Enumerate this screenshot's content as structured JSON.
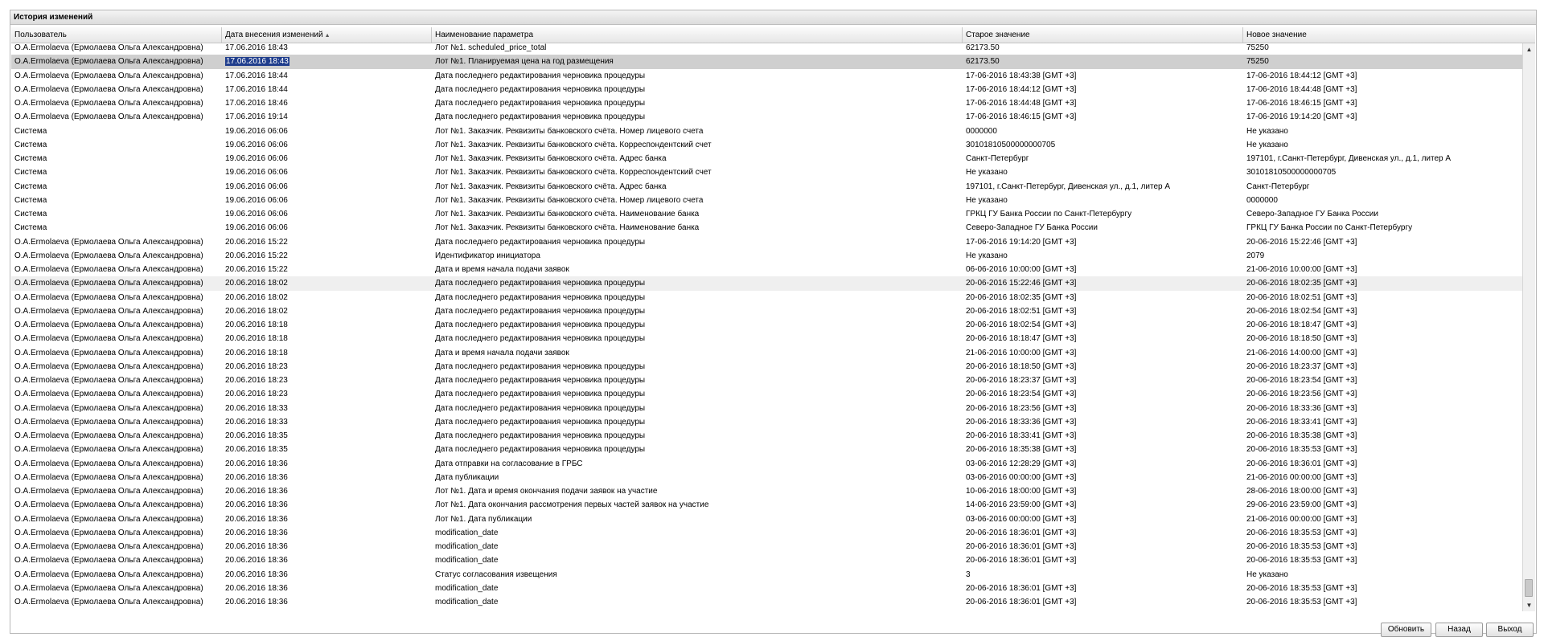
{
  "window": {
    "title": "История изменений"
  },
  "grid": {
    "columns": [
      "Пользователь",
      "Дата внесения изменений",
      "Наименование параметра",
      "Старое значение",
      "Новое значение"
    ],
    "sort_column": 1,
    "selected_row": 1,
    "hover_row": 17,
    "rows": [
      [
        "O.A.Ermolaeva (Ермолаева Ольга Александровна)",
        "17.06.2016 18:43",
        "Лот №1. scheduled_price_total",
        "62173.50",
        "75250"
      ],
      [
        "O.A.Ermolaeva (Ермолаева Ольга Александровна)",
        "17.06.2016 18:43",
        "Лот №1. Планируемая цена на год размещения",
        "62173.50",
        "75250"
      ],
      [
        "O.A.Ermolaeva (Ермолаева Ольга Александровна)",
        "17.06.2016 18:44",
        "Дата последнего редактирования черновика процедуры",
        "17-06-2016 18:43:38 [GMT +3]",
        "17-06-2016 18:44:12 [GMT +3]"
      ],
      [
        "O.A.Ermolaeva (Ермолаева Ольга Александровна)",
        "17.06.2016 18:44",
        "Дата последнего редактирования черновика процедуры",
        "17-06-2016 18:44:12 [GMT +3]",
        "17-06-2016 18:44:48 [GMT +3]"
      ],
      [
        "O.A.Ermolaeva (Ермолаева Ольга Александровна)",
        "17.06.2016 18:46",
        "Дата последнего редактирования черновика процедуры",
        "17-06-2016 18:44:48 [GMT +3]",
        "17-06-2016 18:46:15 [GMT +3]"
      ],
      [
        "O.A.Ermolaeva (Ермолаева Ольга Александровна)",
        "17.06.2016 19:14",
        "Дата последнего редактирования черновика процедуры",
        "17-06-2016 18:46:15 [GMT +3]",
        "17-06-2016 19:14:20 [GMT +3]"
      ],
      [
        "Система",
        "19.06.2016 06:06",
        "Лот №1. Заказчик. Реквизиты банковского счёта. Номер лицевого счета",
        "0000000",
        "Не указано"
      ],
      [
        "Система",
        "19.06.2016 06:06",
        "Лот №1. Заказчик. Реквизиты банковского счёта. Корреспондентский счет",
        "30101810500000000705",
        "Не указано"
      ],
      [
        "Система",
        "19.06.2016 06:06",
        "Лот №1. Заказчик. Реквизиты банковского счёта. Адрес банка",
        "Санкт-Петербург",
        "197101, г.Санкт-Петербург, Дивенская ул., д.1, литер А"
      ],
      [
        "Система",
        "19.06.2016 06:06",
        "Лот №1. Заказчик. Реквизиты банковского счёта. Корреспондентский счет",
        "Не указано",
        "30101810500000000705"
      ],
      [
        "Система",
        "19.06.2016 06:06",
        "Лот №1. Заказчик. Реквизиты банковского счёта. Адрес банка",
        "197101, г.Санкт-Петербург, Дивенская ул., д.1, литер А",
        "Санкт-Петербург"
      ],
      [
        "Система",
        "19.06.2016 06:06",
        "Лот №1. Заказчик. Реквизиты банковского счёта. Номер лицевого счета",
        "Не указано",
        "0000000"
      ],
      [
        "Система",
        "19.06.2016 06:06",
        "Лот №1. Заказчик. Реквизиты банковского счёта. Наименование банка",
        "ГРКЦ ГУ Банка России по Санкт-Петербургу",
        "Северо-Западное ГУ Банка России"
      ],
      [
        "Система",
        "19.06.2016 06:06",
        "Лот №1. Заказчик. Реквизиты банковского счёта. Наименование банка",
        "Северо-Западное ГУ Банка России",
        "ГРКЦ ГУ Банка России по Санкт-Петербургу"
      ],
      [
        "O.A.Ermolaeva (Ермолаева Ольга Александровна)",
        "20.06.2016 15:22",
        "Дата последнего редактирования черновика процедуры",
        "17-06-2016 19:14:20 [GMT +3]",
        "20-06-2016 15:22:46 [GMT +3]"
      ],
      [
        "O.A.Ermolaeva (Ермолаева Ольга Александровна)",
        "20.06.2016 15:22",
        "Идентификатор инициатора",
        "Не указано",
        "2079"
      ],
      [
        "O.A.Ermolaeva (Ермолаева Ольга Александровна)",
        "20.06.2016 15:22",
        "Дата и время начала подачи заявок",
        "06-06-2016 10:00:00 [GMT +3]",
        "21-06-2016 10:00:00 [GMT +3]"
      ],
      [
        "O.A.Ermolaeva (Ермолаева Ольга Александровна)",
        "20.06.2016 18:02",
        "Дата последнего редактирования черновика процедуры",
        "20-06-2016 15:22:46 [GMT +3]",
        "20-06-2016 18:02:35 [GMT +3]"
      ],
      [
        "O.A.Ermolaeva (Ермолаева Ольга Александровна)",
        "20.06.2016 18:02",
        "Дата последнего редактирования черновика процедуры",
        "20-06-2016 18:02:35 [GMT +3]",
        "20-06-2016 18:02:51 [GMT +3]"
      ],
      [
        "O.A.Ermolaeva (Ермолаева Ольга Александровна)",
        "20.06.2016 18:02",
        "Дата последнего редактирования черновика процедуры",
        "20-06-2016 18:02:51 [GMT +3]",
        "20-06-2016 18:02:54 [GMT +3]"
      ],
      [
        "O.A.Ermolaeva (Ермолаева Ольга Александровна)",
        "20.06.2016 18:18",
        "Дата последнего редактирования черновика процедуры",
        "20-06-2016 18:02:54 [GMT +3]",
        "20-06-2016 18:18:47 [GMT +3]"
      ],
      [
        "O.A.Ermolaeva (Ермолаева Ольга Александровна)",
        "20.06.2016 18:18",
        "Дата последнего редактирования черновика процедуры",
        "20-06-2016 18:18:47 [GMT +3]",
        "20-06-2016 18:18:50 [GMT +3]"
      ],
      [
        "O.A.Ermolaeva (Ермолаева Ольга Александровна)",
        "20.06.2016 18:18",
        "Дата и время начала подачи заявок",
        "21-06-2016 10:00:00 [GMT +3]",
        "21-06-2016 14:00:00 [GMT +3]"
      ],
      [
        "O.A.Ermolaeva (Ермолаева Ольга Александровна)",
        "20.06.2016 18:23",
        "Дата последнего редактирования черновика процедуры",
        "20-06-2016 18:18:50 [GMT +3]",
        "20-06-2016 18:23:37 [GMT +3]"
      ],
      [
        "O.A.Ermolaeva (Ермолаева Ольга Александровна)",
        "20.06.2016 18:23",
        "Дата последнего редактирования черновика процедуры",
        "20-06-2016 18:23:37 [GMT +3]",
        "20-06-2016 18:23:54 [GMT +3]"
      ],
      [
        "O.A.Ermolaeva (Ермолаева Ольга Александровна)",
        "20.06.2016 18:23",
        "Дата последнего редактирования черновика процедуры",
        "20-06-2016 18:23:54 [GMT +3]",
        "20-06-2016 18:23:56 [GMT +3]"
      ],
      [
        "O.A.Ermolaeva (Ермолаева Ольга Александровна)",
        "20.06.2016 18:33",
        "Дата последнего редактирования черновика процедуры",
        "20-06-2016 18:23:56 [GMT +3]",
        "20-06-2016 18:33:36 [GMT +3]"
      ],
      [
        "O.A.Ermolaeva (Ермолаева Ольга Александровна)",
        "20.06.2016 18:33",
        "Дата последнего редактирования черновика процедуры",
        "20-06-2016 18:33:36 [GMT +3]",
        "20-06-2016 18:33:41 [GMT +3]"
      ],
      [
        "O.A.Ermolaeva (Ермолаева Ольга Александровна)",
        "20.06.2016 18:35",
        "Дата последнего редактирования черновика процедуры",
        "20-06-2016 18:33:41 [GMT +3]",
        "20-06-2016 18:35:38 [GMT +3]"
      ],
      [
        "O.A.Ermolaeva (Ермолаева Ольга Александровна)",
        "20.06.2016 18:35",
        "Дата последнего редактирования черновика процедуры",
        "20-06-2016 18:35:38 [GMT +3]",
        "20-06-2016 18:35:53 [GMT +3]"
      ],
      [
        "O.A.Ermolaeva (Ермолаева Ольга Александровна)",
        "20.06.2016 18:36",
        "Дата отправки на согласование в ГРБС",
        "03-06-2016 12:28:29 [GMT +3]",
        "20-06-2016 18:36:01 [GMT +3]"
      ],
      [
        "O.A.Ermolaeva (Ермолаева Ольга Александровна)",
        "20.06.2016 18:36",
        "Дата публикации",
        "03-06-2016 00:00:00 [GMT +3]",
        "21-06-2016 00:00:00 [GMT +3]"
      ],
      [
        "O.A.Ermolaeva (Ермолаева Ольга Александровна)",
        "20.06.2016 18:36",
        "Лот №1. Дата и время окончания подачи заявок на участие",
        "10-06-2016 18:00:00 [GMT +3]",
        "28-06-2016 18:00:00 [GMT +3]"
      ],
      [
        "O.A.Ermolaeva (Ермолаева Ольга Александровна)",
        "20.06.2016 18:36",
        "Лот №1. Дата окончания рассмотрения первых частей заявок на участие",
        "14-06-2016 23:59:00 [GMT +3]",
        "29-06-2016 23:59:00 [GMT +3]"
      ],
      [
        "O.A.Ermolaeva (Ермолаева Ольга Александровна)",
        "20.06.2016 18:36",
        "Лот №1. Дата публикации",
        "03-06-2016 00:00:00 [GMT +3]",
        "21-06-2016 00:00:00 [GMT +3]"
      ],
      [
        "O.A.Ermolaeva (Ермолаева Ольга Александровна)",
        "20.06.2016 18:36",
        "modification_date",
        "20-06-2016 18:36:01 [GMT +3]",
        "20-06-2016 18:35:53 [GMT +3]"
      ],
      [
        "O.A.Ermolaeva (Ермолаева Ольга Александровна)",
        "20.06.2016 18:36",
        "modification_date",
        "20-06-2016 18:36:01 [GMT +3]",
        "20-06-2016 18:35:53 [GMT +3]"
      ],
      [
        "O.A.Ermolaeva (Ермолаева Ольга Александровна)",
        "20.06.2016 18:36",
        "modification_date",
        "20-06-2016 18:36:01 [GMT +3]",
        "20-06-2016 18:35:53 [GMT +3]"
      ],
      [
        "O.A.Ermolaeva (Ермолаева Ольга Александровна)",
        "20.06.2016 18:36",
        "Статус согласования извещения",
        "3",
        "Не указано"
      ],
      [
        "O.A.Ermolaeva (Ермолаева Ольга Александровна)",
        "20.06.2016 18:36",
        "modification_date",
        "20-06-2016 18:36:01 [GMT +3]",
        "20-06-2016 18:35:53 [GMT +3]"
      ],
      [
        "O.A.Ermolaeva (Ермолаева Ольга Александровна)",
        "20.06.2016 18:36",
        "modification_date",
        "20-06-2016 18:36:01 [GMT +3]",
        "20-06-2016 18:35:53 [GMT +3]"
      ]
    ]
  },
  "buttons": {
    "refresh": "Обновить",
    "back": "Назад",
    "exit": "Выход"
  },
  "icons": {
    "sort": "sort-ascending-icon",
    "scroll_up": "scroll-up-arrow-icon",
    "scroll_down": "scroll-down-arrow-icon"
  },
  "colors": {
    "selection_bg": "#cfcfcf",
    "text_highlight": "#1f3d8c",
    "hover_bg": "#efefef"
  }
}
